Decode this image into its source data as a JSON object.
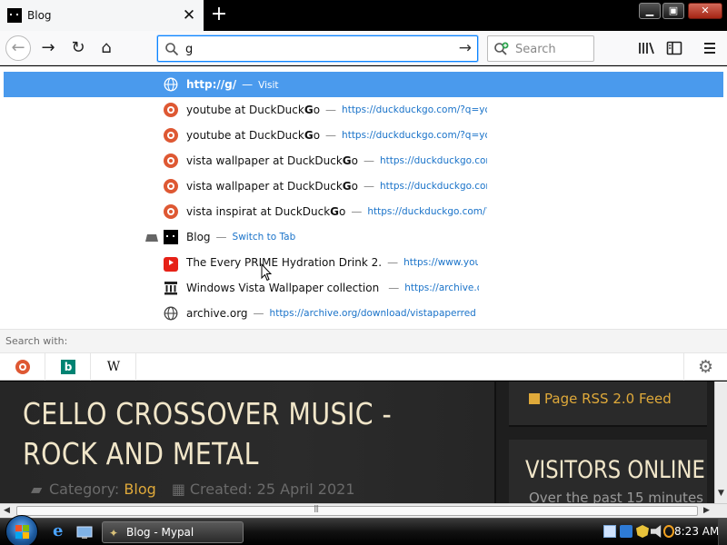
{
  "tab": {
    "title": "Blog",
    "close_glyph": "✕",
    "new_tab_glyph": "+"
  },
  "window_controls": {
    "minimize": "▁",
    "maximize": "▣",
    "close": "✕"
  },
  "nav": {
    "back_glyph": "←",
    "forward_glyph": "→",
    "reload_glyph": "↻",
    "home_glyph": "⌂"
  },
  "urlbar": {
    "value": "g",
    "go_glyph": "→"
  },
  "searchbar": {
    "placeholder": "Search"
  },
  "autocomplete": {
    "visit_row": {
      "url": "http://g/",
      "action": "Visit"
    },
    "rows": [
      {
        "icon": "duckduckgo-icon",
        "title_pre": "youtube at DuckDuck",
        "title_bold": "G",
        "title_post": "o",
        "url": "https://duckduckgo.com/?q=you"
      },
      {
        "icon": "duckduckgo-icon",
        "title_pre": "youtube at DuckDuck",
        "title_bold": "G",
        "title_post": "o",
        "url": "https://duckduckgo.com/?q=you"
      },
      {
        "icon": "duckduckgo-icon",
        "title_pre": "vista wallpaper at DuckDuck",
        "title_bold": "G",
        "title_post": "o",
        "url": "https://duckduckgo.com"
      },
      {
        "icon": "duckduckgo-icon",
        "title_pre": "vista wallpaper at DuckDuck",
        "title_bold": "G",
        "title_post": "o",
        "url": "https://duckduckgo.com"
      },
      {
        "icon": "duckduckgo-icon",
        "title_pre": "vista inspirat at DuckDuck",
        "title_bold": "G",
        "title_post": "o",
        "url": "https://duckduckgo.com/?c"
      }
    ],
    "switch_row": {
      "title": "Blog",
      "action": "Switch to Tab"
    },
    "history_rows": [
      {
        "icon": "youtube-icon",
        "title": "The Every PRIME Hydration Drink 2.",
        "url": "https://www.you"
      },
      {
        "icon": "archive-icon",
        "title": "Windows Vista Wallpaper collection",
        "url": "https://archive.o"
      },
      {
        "icon": "globe-icon",
        "title": "archive.org",
        "url": "https://archive.org/download/vistapaperredve"
      }
    ],
    "separator": "—"
  },
  "search_with": {
    "label": "Search with:",
    "engines": [
      {
        "name": "duckduckgo-icon"
      },
      {
        "name": "bing-icon",
        "glyph": "b"
      },
      {
        "name": "wikipedia-icon",
        "glyph": "W"
      }
    ],
    "settings_glyph": "⚙"
  },
  "page": {
    "title": "CELLO CROSSOVER MUSIC - ROCK AND METAL",
    "category_label": "Category:",
    "category_value": "Blog",
    "created_label": "Created: 25 April 2021",
    "rss_label": "Page RSS 2.0 Feed",
    "visitors_title": "VISITORS ONLINE",
    "visitors_sub": "Over the past 15 minutes",
    "accent_color": "#dfa93a",
    "title_color": "#f1e6c9"
  },
  "taskbar": {
    "task_label": "Blog - Mypal",
    "clock": "8:23 AM"
  },
  "colors": {
    "selection": "#4a9aed",
    "url_link": "#1a73c9",
    "focus_ring": "#0a84ff"
  }
}
